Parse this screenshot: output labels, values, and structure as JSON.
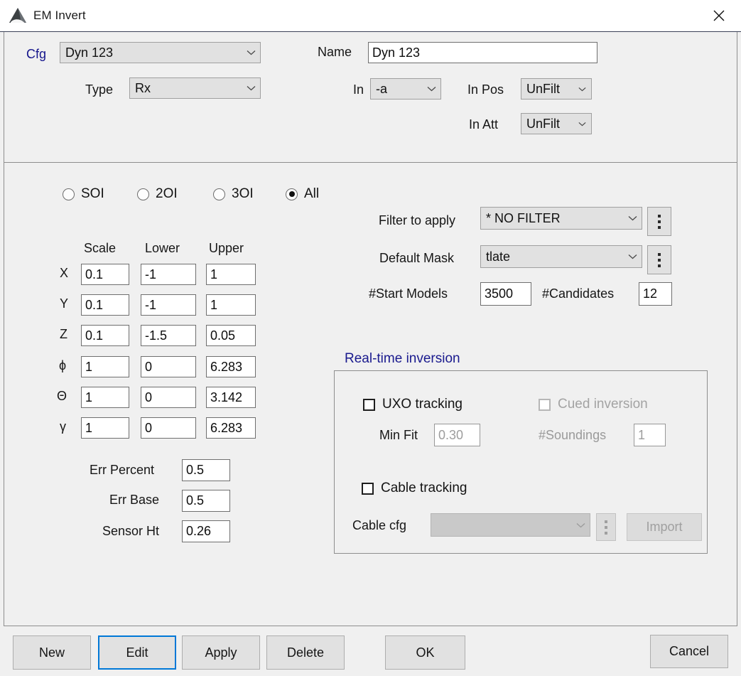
{
  "window": {
    "title": "EM Invert",
    "icon": "mountain-triangle-icon",
    "close_label": "×"
  },
  "config": {
    "cfg_label": "Cfg",
    "cfg_value": "Dyn 123",
    "type_label": "Type",
    "type_value": "Rx",
    "name_label": "Name",
    "name_value": "Dyn 123",
    "in_label": "In",
    "in_value": "-a",
    "in_pos_label": "In Pos",
    "in_pos_value": "UnFilt",
    "in_att_label": "In Att",
    "in_att_value": "UnFilt"
  },
  "order_radios": [
    {
      "label": "SOI",
      "selected": false
    },
    {
      "label": "2OI",
      "selected": false
    },
    {
      "label": "3OI",
      "selected": false
    },
    {
      "label": "All",
      "selected": true
    }
  ],
  "param_table": {
    "headers": [
      "Scale",
      "Lower",
      "Upper"
    ],
    "rows": [
      {
        "name": "X",
        "scale": "0.1",
        "lower": "-1",
        "upper": "1"
      },
      {
        "name": "Y",
        "scale": "0.1",
        "lower": "-1",
        "upper": "1"
      },
      {
        "name": "Z",
        "scale": "0.1",
        "lower": "-1.5",
        "upper": "0.05"
      },
      {
        "name": "ϕ",
        "scale": "1",
        "lower": "0",
        "upper": "6.283"
      },
      {
        "name": "Θ",
        "scale": "1",
        "lower": "0",
        "upper": "3.142"
      },
      {
        "name": "γ",
        "scale": "1",
        "lower": "0",
        "upper": "6.283"
      }
    ]
  },
  "error_fields": {
    "err_percent_label": "Err Percent",
    "err_percent_value": "0.5",
    "err_base_label": "Err Base",
    "err_base_value": "0.5",
    "sensor_ht_label": "Sensor Ht",
    "sensor_ht_value": "0.26"
  },
  "filters": {
    "filter_label": "Filter to apply",
    "filter_value": "* NO FILTER",
    "mask_label": "Default Mask",
    "mask_value": "tlate",
    "start_models_label": "#Start Models",
    "start_models_value": "3500",
    "candidates_label": "#Candidates",
    "candidates_value": "12"
  },
  "realtime": {
    "title": "Real-time inversion",
    "uxo_tracking_label": "UXO tracking",
    "uxo_tracking_checked": false,
    "cued_inversion_label": "Cued inversion",
    "cued_inversion_checked": false,
    "min_fit_label": "Min Fit",
    "min_fit_value": "0.30",
    "soundings_label": "#Soundings",
    "soundings_value": "1",
    "cable_tracking_label": "Cable tracking",
    "cable_tracking_checked": false,
    "cable_cfg_label": "Cable cfg",
    "cable_cfg_value": "",
    "import_label": "Import"
  },
  "footer": {
    "new_label": "New",
    "edit_label": "Edit",
    "apply_label": "Apply",
    "delete_label": "Delete",
    "ok_label": "OK",
    "cancel_label": "Cancel"
  },
  "colors": {
    "accent_blue": "#15158c",
    "focus_blue": "#0078d7",
    "window_bg": "#f0f0f0",
    "control_bg": "#e1e1e1",
    "field_bg": "#ffffff"
  }
}
